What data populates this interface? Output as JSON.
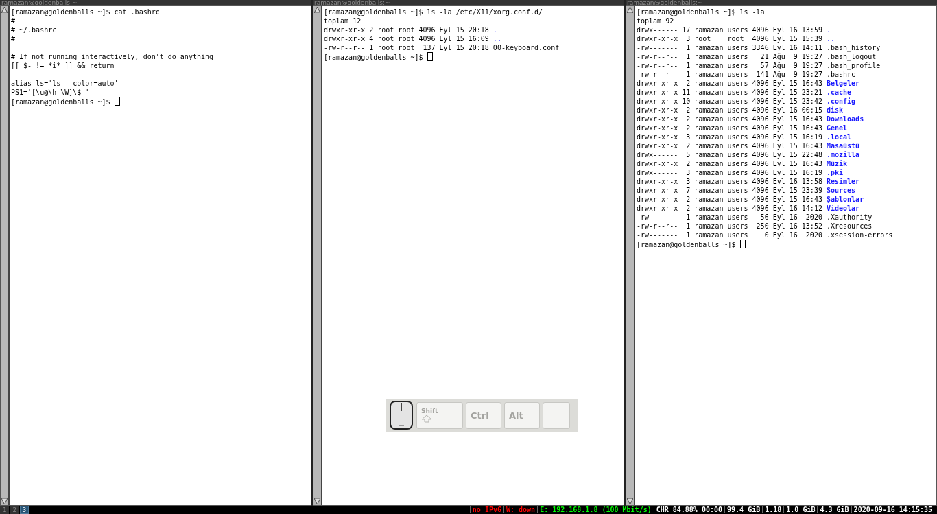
{
  "panes": [
    {
      "title": "ramazan@goldenballs:~",
      "lines": [
        {
          "kind": "text",
          "text": "[ramazan@goldenballs ~]$ cat .bashrc"
        },
        {
          "kind": "text",
          "text": "#"
        },
        {
          "kind": "text",
          "text": "# ~/.bashrc"
        },
        {
          "kind": "text",
          "text": "#"
        },
        {
          "kind": "blank"
        },
        {
          "kind": "text",
          "text": "# If not running interactively, don't do anything"
        },
        {
          "kind": "text",
          "text": "[[ $- != *i* ]] && return"
        },
        {
          "kind": "blank"
        },
        {
          "kind": "text",
          "text": "alias ls='ls --color=auto'"
        },
        {
          "kind": "text",
          "text": "PS1='[\\u@\\h \\W]\\$ '"
        },
        {
          "kind": "prompt",
          "text": "[ramazan@goldenballs ~]$"
        }
      ]
    },
    {
      "title": "ramazan@goldenballs:~",
      "lines": [
        {
          "kind": "text",
          "text": "[ramazan@goldenballs ~]$ ls -la /etc/X11/xorg.conf.d/"
        },
        {
          "kind": "text",
          "text": "toplam 12"
        },
        {
          "kind": "dir",
          "text": "drwxr-xr-x 2 root root 4096 Eyl 15 20:18",
          "name": "."
        },
        {
          "kind": "dir",
          "text": "drwxr-xr-x 4 root root 4096 Eyl 15 16:09",
          "name": ".."
        },
        {
          "kind": "file",
          "text": "-rw-r--r-- 1 root root  137 Eyl 15 20:18",
          "name": "00-keyboard.conf"
        },
        {
          "kind": "prompt",
          "text": "[ramazan@goldenballs ~]$"
        }
      ]
    },
    {
      "title": "ramazan@goldenballs:~",
      "lines": [
        {
          "kind": "text",
          "text": "[ramazan@goldenballs ~]$ ls -la"
        },
        {
          "kind": "text",
          "text": "toplam 92"
        },
        {
          "kind": "dir",
          "text": "drwx------ 17 ramazan users 4096 Eyl 16 13:59",
          "name": "."
        },
        {
          "kind": "dir",
          "text": "drwxr-xr-x  3 root    root  4096 Eyl 15 15:39",
          "name": ".."
        },
        {
          "kind": "file",
          "text": "-rw-------  1 ramazan users 3346 Eyl 16 14:11",
          "name": ".bash_history"
        },
        {
          "kind": "file",
          "text": "-rw-r--r--  1 ramazan users   21 Ağu  9 19:27",
          "name": ".bash_logout"
        },
        {
          "kind": "file",
          "text": "-rw-r--r--  1 ramazan users   57 Ağu  9 19:27",
          "name": ".bash_profile"
        },
        {
          "kind": "file",
          "text": "-rw-r--r--  1 ramazan users  141 Ağu  9 19:27",
          "name": ".bashrc"
        },
        {
          "kind": "dirbold",
          "text": "drwxr-xr-x  2 ramazan users 4096 Eyl 15 16:43",
          "name": "Belgeler"
        },
        {
          "kind": "dirbold",
          "text": "drwxr-xr-x 11 ramazan users 4096 Eyl 15 23:21",
          "name": ".cache"
        },
        {
          "kind": "dirbold",
          "text": "drwxr-xr-x 10 ramazan users 4096 Eyl 15 23:42",
          "name": ".config"
        },
        {
          "kind": "dirbold",
          "text": "drwxr-xr-x  2 ramazan users 4096 Eyl 16 00:15",
          "name": "disk"
        },
        {
          "kind": "dirbold",
          "text": "drwxr-xr-x  2 ramazan users 4096 Eyl 15 16:43",
          "name": "Downloads"
        },
        {
          "kind": "dirbold",
          "text": "drwxr-xr-x  2 ramazan users 4096 Eyl 15 16:43",
          "name": "Genel"
        },
        {
          "kind": "dirbold",
          "text": "drwxr-xr-x  3 ramazan users 4096 Eyl 15 16:19",
          "name": ".local"
        },
        {
          "kind": "dirbold",
          "text": "drwxr-xr-x  2 ramazan users 4096 Eyl 15 16:43",
          "name": "Masaüstü"
        },
        {
          "kind": "dirbold",
          "text": "drwx------  5 ramazan users 4096 Eyl 15 22:48",
          "name": ".mozilla"
        },
        {
          "kind": "dirbold",
          "text": "drwxr-xr-x  2 ramazan users 4096 Eyl 15 16:43",
          "name": "Müzik"
        },
        {
          "kind": "dirbold",
          "text": "drwx------  3 ramazan users 4096 Eyl 15 16:19",
          "name": ".pki"
        },
        {
          "kind": "dirbold",
          "text": "drwxr-xr-x  3 ramazan users 4096 Eyl 16 13:58",
          "name": "Resimler"
        },
        {
          "kind": "dirbold",
          "text": "drwxr-xr-x  7 ramazan users 4096 Eyl 15 23:39",
          "name": "Sources"
        },
        {
          "kind": "dirbold",
          "text": "drwxr-xr-x  2 ramazan users 4096 Eyl 15 16:43",
          "name": "Şablonlar"
        },
        {
          "kind": "dirbold",
          "text": "drwxr-xr-x  2 ramazan users 4096 Eyl 16 14:12",
          "name": "Videolar"
        },
        {
          "kind": "file",
          "text": "-rw-------  1 ramazan users   56 Eyl 16  2020",
          "name": ".Xauthority"
        },
        {
          "kind": "file",
          "text": "-rw-r--r--  1 ramazan users  250 Eyl 16 13:52",
          "name": ".Xresources"
        },
        {
          "kind": "file",
          "text": "-rw-------  1 ramazan users    0 Eyl 16  2020",
          "name": ".xsession-errors"
        },
        {
          "kind": "prompt",
          "text": "[ramazan@goldenballs ~]$"
        }
      ]
    }
  ],
  "key_overlay": {
    "keys": [
      {
        "kind": "shift",
        "label": "Shift"
      },
      {
        "kind": "plain",
        "label": "Ctrl"
      },
      {
        "kind": "plain",
        "label": "Alt"
      },
      {
        "kind": "blank"
      }
    ]
  },
  "status_bar": {
    "workspaces": [
      {
        "label": "1",
        "selected": false
      },
      {
        "label": "2",
        "selected": false
      },
      {
        "label": "3",
        "selected": true
      }
    ],
    "items": [
      {
        "text": "no IPv6",
        "color": "#ff0000"
      },
      {
        "text": "W: down",
        "color": "#ff0000"
      },
      {
        "text": "E: 192.168.1.8 (100 Mbit/s)",
        "color": "#00ff00"
      },
      {
        "text": "CHR 84.88% 00:00",
        "color": "#ffffff"
      },
      {
        "text": "99.4 GiB",
        "color": "#ffffff"
      },
      {
        "text": "1.18",
        "color": "#ffffff"
      },
      {
        "text": "1.0 GiB",
        "color": "#ffffff"
      },
      {
        "text": "4.3 GiB",
        "color": "#ffffff"
      },
      {
        "text": "2020-09-16 14:15:35",
        "color": "#ffffff"
      }
    ]
  }
}
